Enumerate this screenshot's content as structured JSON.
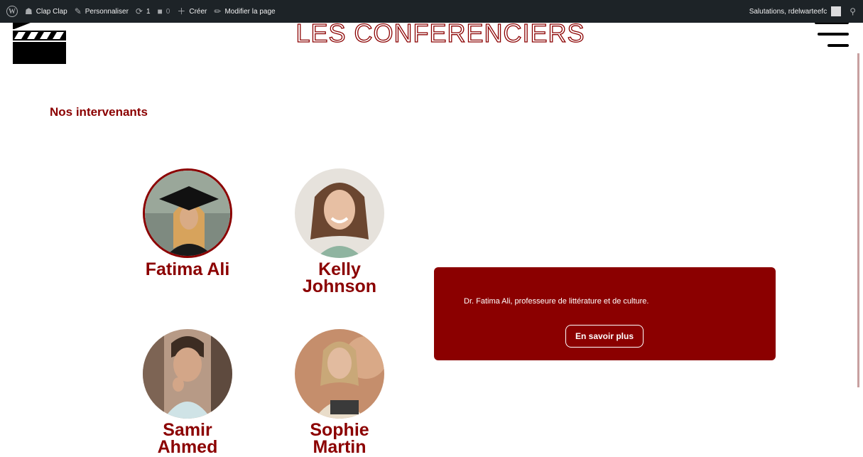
{
  "admin_bar": {
    "site_name": "Clap Clap",
    "customize": "Personnaliser",
    "updates_count": "1",
    "comments_count": "0",
    "create": "Créer",
    "edit_page": "Modifier la page",
    "greeting": "Salutations, rdelwarteefc"
  },
  "header": {
    "title": "LES CONFERENCIERS"
  },
  "section": {
    "title": "Nos intervenants"
  },
  "speakers": [
    {
      "name": "Fatima Ali"
    },
    {
      "name": "Kelly Johnson"
    },
    {
      "name": "Samir Ahmed"
    },
    {
      "name": "Sophie Martin"
    }
  ],
  "info": {
    "text": "Dr. Fatima Ali, professeure de littérature et de culture.",
    "button": "En savoir plus"
  },
  "colors": {
    "accent": "#8b0000",
    "admin_bar": "#1d2327"
  }
}
